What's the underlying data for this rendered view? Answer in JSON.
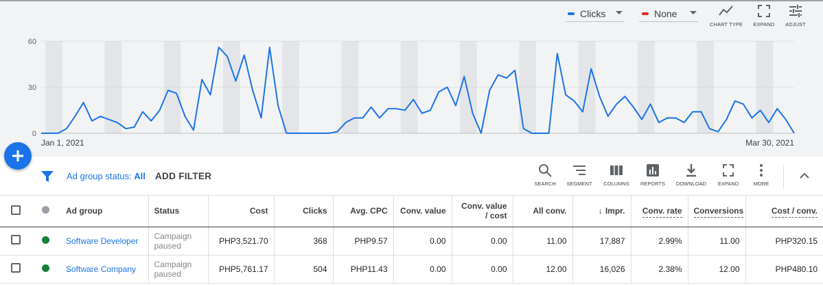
{
  "chart_controls": {
    "primary_metric": "Clicks",
    "primary_color": "#1a73e8",
    "secondary_metric": "None",
    "secondary_color": "#d93025",
    "tools": [
      {
        "label": "CHART TYPE",
        "icon": "line-chart-icon"
      },
      {
        "label": "EXPAND",
        "icon": "expand-icon"
      },
      {
        "label": "ADJUST",
        "icon": "tune-icon"
      }
    ]
  },
  "chart_data": {
    "type": "line",
    "series": [
      {
        "name": "Clicks",
        "color": "#1a73e8",
        "values": [
          0,
          0,
          0,
          3,
          11,
          20,
          8,
          11,
          9,
          7,
          3,
          4,
          14,
          8,
          15,
          28,
          26,
          11,
          2,
          35,
          25,
          56,
          50,
          34,
          51,
          28,
          10,
          56,
          18,
          0,
          0,
          0,
          0,
          0,
          0,
          1,
          7,
          10,
          10,
          17,
          10,
          16,
          16,
          15,
          22,
          13,
          15,
          27,
          30,
          18,
          37,
          13,
          0,
          28,
          38,
          36,
          41,
          3,
          0,
          0,
          0,
          52,
          25,
          21,
          14,
          42,
          24,
          11,
          19,
          24,
          17,
          9,
          19,
          7,
          10,
          10,
          7,
          14,
          14,
          3,
          1,
          9,
          21,
          19,
          10,
          15,
          7,
          16,
          9,
          0
        ]
      }
    ],
    "x_labels": {
      "start": "Jan 1, 2021",
      "end": "Mar 30, 2021"
    },
    "y_ticks": [
      0,
      30,
      60
    ],
    "ylim": [
      0,
      60
    ],
    "grid": true,
    "weekend_bands": true
  },
  "toolbar": {
    "filter_label": "Ad group status:",
    "filter_value": "All",
    "add_filter": "ADD FILTER",
    "tools": [
      {
        "label": "SEARCH",
        "icon": "search-icon"
      },
      {
        "label": "SEGMENT",
        "icon": "segment-icon"
      },
      {
        "label": "COLUMNS",
        "icon": "columns-icon"
      },
      {
        "label": "REPORTS",
        "icon": "reports-icon"
      },
      {
        "label": "DOWNLOAD",
        "icon": "download-icon"
      },
      {
        "label": "EXPAND",
        "icon": "expand-icon"
      },
      {
        "label": "MORE",
        "icon": "more-vert-icon"
      }
    ]
  },
  "table": {
    "headers": {
      "ad_group": "Ad group",
      "status": "Status",
      "cost": "Cost",
      "clicks": "Clicks",
      "avg_cpc": "Avg. CPC",
      "conv_value": "Conv. value",
      "conv_value_cost": "Conv. value / cost",
      "all_conv": "All conv.",
      "impr": "Impr.",
      "conv_rate": "Conv. rate",
      "conversions": "Conversions",
      "cost_conv": "Cost / conv."
    },
    "rows": [
      {
        "status_color": "#188038",
        "ad_group": "Software Developer",
        "status": "Campaign paused",
        "cost": "PHP3,521.70",
        "clicks": "368",
        "avg_cpc": "PHP9.57",
        "conv_value": "0.00",
        "conv_value_cost": "0.00",
        "all_conv": "11.00",
        "impr": "17,887",
        "conv_rate": "2.99%",
        "conversions": "11.00",
        "cost_conv": "PHP320.15"
      },
      {
        "status_color": "#188038",
        "ad_group": "Software Company",
        "status": "Campaign paused",
        "cost": "PHP5,761.17",
        "clicks": "504",
        "avg_cpc": "PHP11.43",
        "conv_value": "0.00",
        "conv_value_cost": "0.00",
        "all_conv": "12.00",
        "impr": "16,026",
        "conv_rate": "2.38%",
        "conversions": "12.00",
        "cost_conv": "PHP480.10"
      }
    ]
  }
}
